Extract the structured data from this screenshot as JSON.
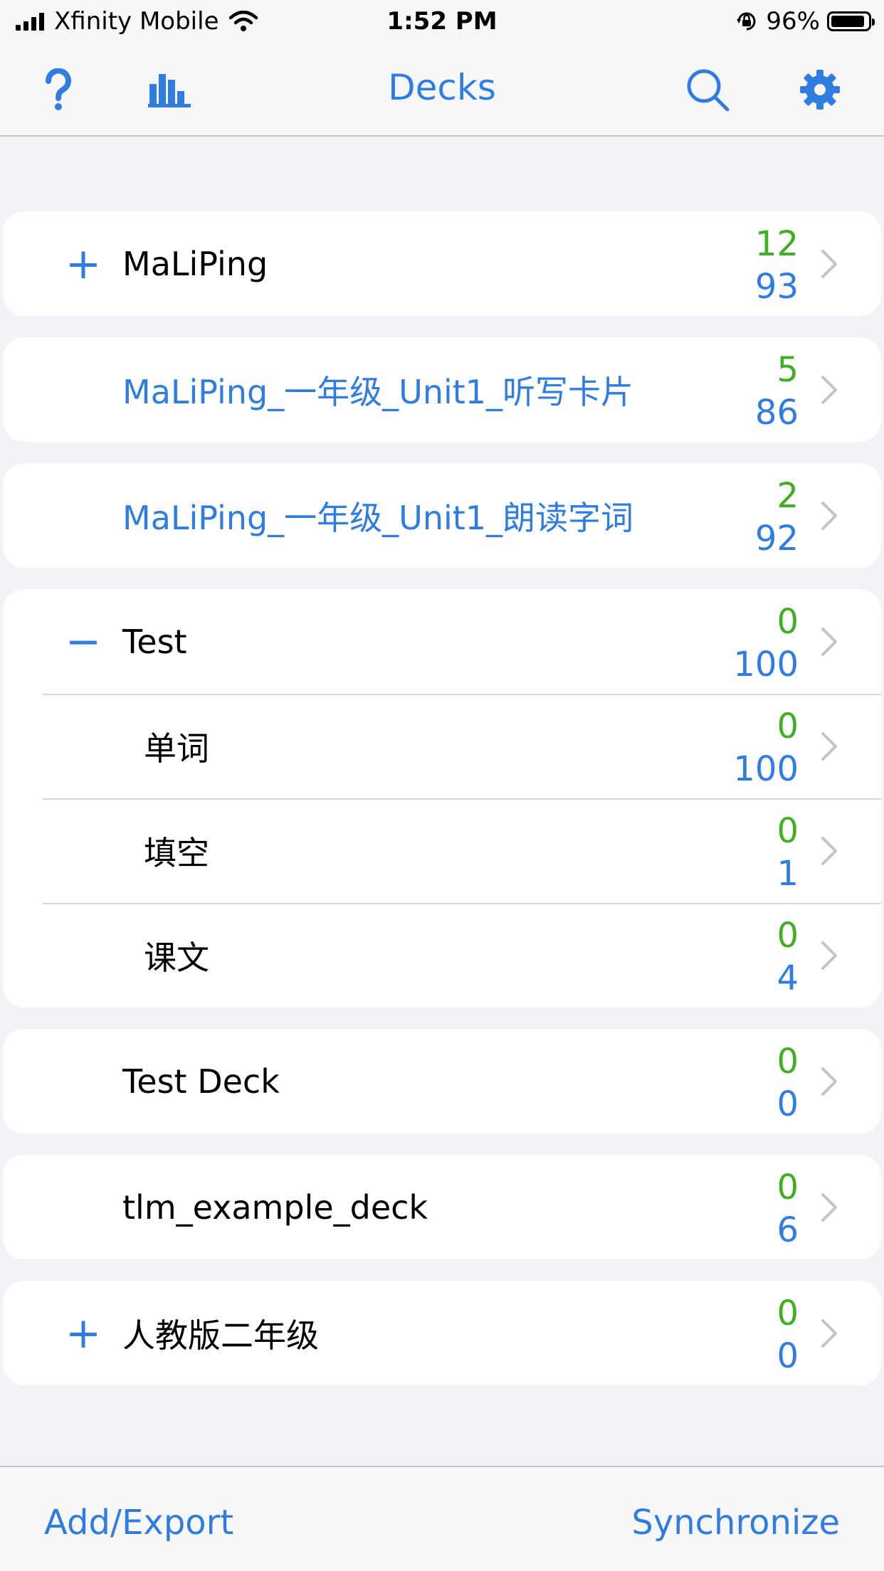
{
  "status_bar": {
    "carrier": "Xfinity Mobile",
    "time": "1:52 PM",
    "battery": "96%",
    "battery_level": 0.96,
    "icons": [
      "signal-icon",
      "wifi-icon",
      "orientation-lock-icon",
      "battery-icon"
    ]
  },
  "nav": {
    "title": "Decks",
    "icons": [
      "help-icon",
      "stats-icon",
      "search-icon",
      "settings-icon"
    ]
  },
  "decks": [
    {
      "toggle": "+",
      "name": "MaLiPing",
      "due": "12",
      "total": "93",
      "link": false
    },
    {
      "toggle": "",
      "name": "MaLiPing_一年级_Unit1_听写卡片",
      "due": "5",
      "total": "86",
      "link": true
    },
    {
      "toggle": "",
      "name": "MaLiPing_一年级_Unit1_朗读字词",
      "due": "2",
      "total": "92",
      "link": true
    },
    {
      "toggle": "−",
      "name": "Test",
      "due": "0",
      "total": "100",
      "link": false
    },
    {
      "toggle": "",
      "name": "单词",
      "due": "0",
      "total": "100",
      "link": false
    },
    {
      "toggle": "",
      "name": "填空",
      "due": "0",
      "total": "1",
      "link": false
    },
    {
      "toggle": "",
      "name": "课文",
      "due": "0",
      "total": "4",
      "link": false
    },
    {
      "toggle": "",
      "name": "Test Deck",
      "due": "0",
      "total": "0",
      "link": false
    },
    {
      "toggle": "",
      "name": "tlm_example_deck",
      "due": "0",
      "total": "6",
      "link": false
    },
    {
      "toggle": "+",
      "name": "人教版二年级",
      "due": "0",
      "total": "0",
      "link": false
    }
  ],
  "toolbar": {
    "add_export": "Add/Export",
    "synchronize": "Synchronize"
  },
  "colors": {
    "accent": "#2f7de1",
    "due": "#3fb022",
    "background": "#f2f2f7"
  }
}
